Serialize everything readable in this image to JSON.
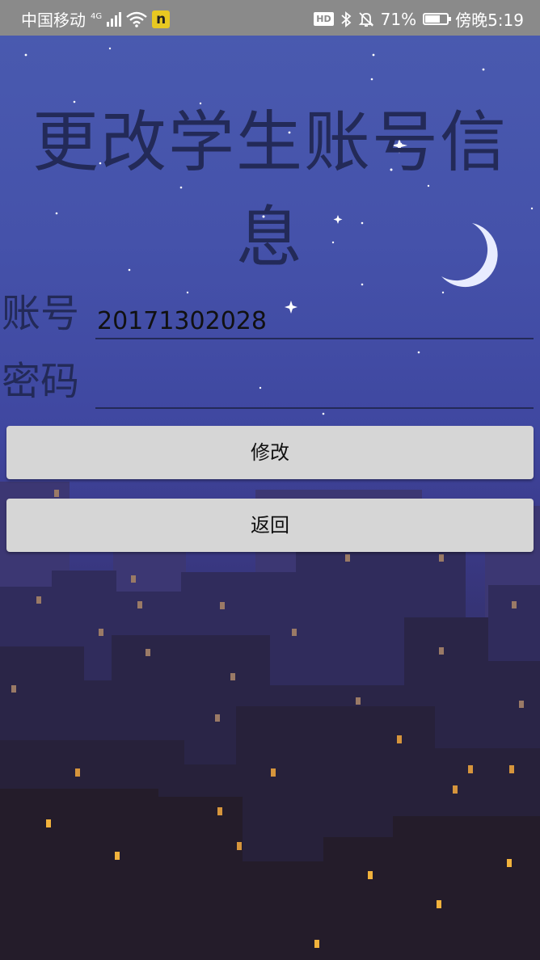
{
  "status_bar": {
    "carrier": "中国移动",
    "network": "4G",
    "app_badge": "n",
    "hd": "HD",
    "battery_percent": "71%",
    "battery_level": 0.71,
    "time": "傍晚5:19",
    "icons": [
      "signal-icon",
      "wifi-icon",
      "app-badge-icon",
      "hd-icon",
      "bluetooth-icon",
      "mute-icon",
      "battery-icon"
    ]
  },
  "page": {
    "title": "更改学生账号信息"
  },
  "form": {
    "account_label": "账号",
    "account_value": "20171302028",
    "password_label": "密码",
    "password_value": ""
  },
  "buttons": {
    "modify_label": "修改",
    "back_label": "返回"
  },
  "colors": {
    "sky_top": "#4a5bb0",
    "sky_bottom": "#251d2b",
    "title_text": "#232a58",
    "button_bg": "#d6d6d6",
    "status_bar": "#8a8a8a",
    "window_light": "#e8a33c"
  }
}
